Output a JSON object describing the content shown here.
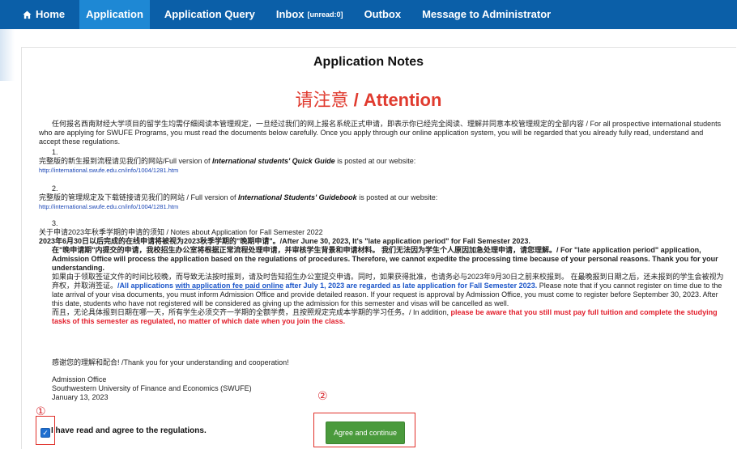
{
  "nav": {
    "items": [
      {
        "label": "Home"
      },
      {
        "label": "Application"
      },
      {
        "label": "Application Query"
      },
      {
        "label": "Inbox",
        "badge": "[unread:0]"
      },
      {
        "label": "Outbox"
      },
      {
        "label": "Message to Administrator"
      }
    ],
    "active": "Application"
  },
  "notes": {
    "title": "Application Notes",
    "attention_cn": "请注意",
    "attention_sep": " / ",
    "attention_en": "Attention",
    "intro": "任何报名西南财经大学项目的留学生均需仔细阅读本管理规定，一旦经过我们的网上报名系统正式申请，即表示你已经完全阅读、理解并同意本校管理规定的全部内容 / For all prospective international students who are applying for SWUFE Programs, you must read the documents below carefully. Once you apply through our online application system, you will be regarded that you already fully read, understand and accept these regulations.",
    "item1": {
      "num": "1.",
      "text_pre": "完整版的新生报到流程请见我们的网站/Full version of ",
      "text_em": "International students' Quick Guide",
      "text_post": " is posted at our website:",
      "link": "http://international.swufe.edu.cn/info/1004/1281.htm"
    },
    "item2": {
      "num": "2.",
      "text_pre": "完整版的管理规定及下载链接请见我们的网站 / Full version of ",
      "text_em": "International Students' Guidebook",
      "text_post": " is posted at our website:",
      "link": "http://international.swufe.edu.cn/info/1004/1281.htm"
    },
    "item3": {
      "num": "3.",
      "line1": "关于申请2023年秋季学期的申请的须知 / Notes about Application for Fall Semester 2022",
      "line2": "2023年6月30日以后完成的在线申请将被视为2023秋季学期的\"晚期申请\"。/After June 30, 2023, It's \"late application period\" for Fall Semester 2023.",
      "line3": "在\"晚申请期\"内提交的申请，我校招生办公室将根据正常流程处理申请，并审核学生背景和申请材料。 我们无法因为学生个人原因加急处理申请，请您理解。/ For \"late application period\" application, Admission Office will process the application based on the regulations of procedures. Therefore, we cannot expedite the processing time because of your personal reasons. Thank you for your understanding.",
      "p4_pre": "如果由于领取签证文件的时间比较晚，而导致无法按时报到，请及时告知招生办公室提交申请。同时，如果获得批准，也请务必与2023年9月30日之前来校报到。 在最晚报到日期之后，还未报到的学生会被视为弃权，并取消签证。",
      "p4_blue1": "/All applications ",
      "p4_blue_u": "with application fee paid online",
      "p4_blue2": " after July 1, 2023 are regarded as late application for Fall Semester 2023.",
      "p4_post": " Please note that if you cannot register on time due to the late arrival of your visa documents, you must inform Admission Office and provide detailed reason. If your request is approval by Admission Office, you must come to register before September 30, 2023. After this date, students who have not registered will be considered as giving up the admission for this semester and visas will be cancelled as well.",
      "p5_pre": "而且，无论具体报到日期在哪一天，所有学生必须交齐一学期的全额学费，且按照规定完成本学期的学习任务。/ In addition, ",
      "p5_red": "please be aware that you still must pay full tuition and complete the studying tasks of this semester as regulated, no matter of which date when you join the class."
    },
    "thanks": "感谢您的理解和配合! /Thank you for your understanding and cooperation!",
    "sign_office": "Admission Office",
    "sign_uni": "Southwestern University of Finance and Economics (SWUFE)",
    "sign_date": "January 13, 2023"
  },
  "agreement": {
    "label": "I have read and agree to the regulations.",
    "button": "Agree and continue",
    "marker1": "①",
    "marker2": "②",
    "checked_glyph": "✓"
  },
  "colors": {
    "nav_bg": "#0b5fa8",
    "nav_active": "#1e88d4",
    "attention_red": "#e03b2f",
    "button_green": "#4a9a3c"
  }
}
